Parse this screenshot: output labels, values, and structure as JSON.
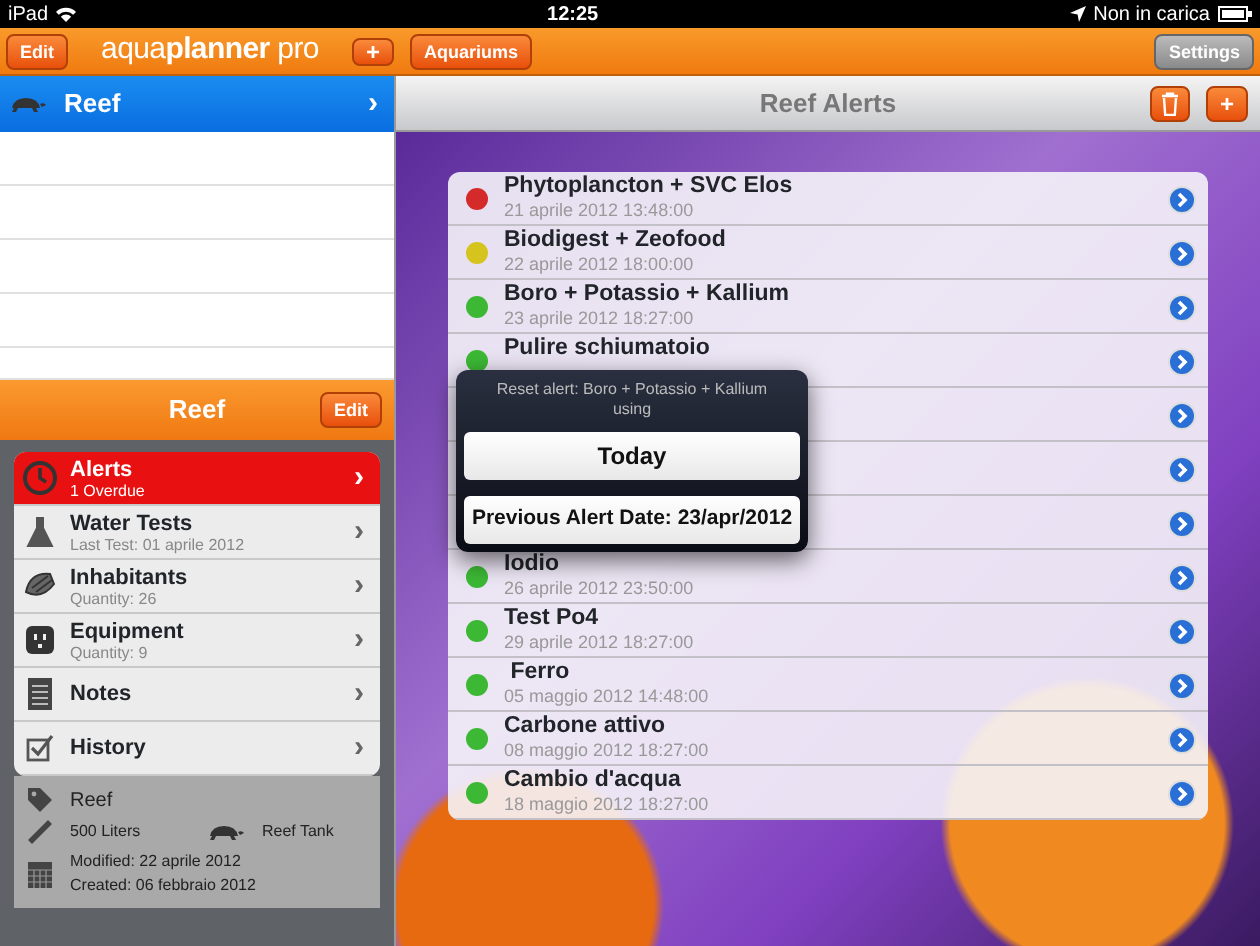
{
  "status_bar": {
    "device": "iPad",
    "time": "12:25",
    "charging": "Non in carica"
  },
  "toolbar": {
    "edit": "Edit",
    "logo_light": "aqua",
    "logo_bold": "planner",
    "logo_suffix": " pro",
    "add": "+",
    "aquariums": "Aquariums",
    "settings": "Settings"
  },
  "aquariums": [
    {
      "name": "Reef",
      "selected": true,
      "chevron": "›"
    }
  ],
  "aquarium_panel": {
    "title": "Reef",
    "edit": "Edit",
    "menu": [
      {
        "kind": "clock",
        "title": "Alerts",
        "subtitle": "1 Overdue",
        "selected": true,
        "chevron": "›"
      },
      {
        "kind": "flask",
        "title": "Water Tests",
        "subtitle": "Last Test: 01 aprile 2012",
        "selected": false,
        "chevron": "›"
      },
      {
        "kind": "shell",
        "title": "Inhabitants",
        "subtitle": "Quantity: 26",
        "selected": false,
        "chevron": "›"
      },
      {
        "kind": "outlet",
        "title": "Equipment",
        "subtitle": "Quantity: 9",
        "selected": false,
        "chevron": "›"
      },
      {
        "kind": "notepad",
        "title": "Notes",
        "selected": false,
        "chevron": "›"
      },
      {
        "kind": "checkbox",
        "title": "History",
        "selected": false,
        "chevron": "›"
      }
    ],
    "info": {
      "name": "Reef",
      "volume": "500 Liters",
      "type": "Reef Tank",
      "modified": "Modified: 22 aprile 2012",
      "created": "Created: 06 febbraio 2012"
    }
  },
  "alerts_header": {
    "title": "Reef Alerts",
    "add": "+"
  },
  "alerts": [
    {
      "kind": "alert",
      "title": "Phytoplancton + SVC Elos",
      "date": "21 aprile 2012 13:48:00",
      "color": "#d42a2a"
    },
    {
      "kind": "alert",
      "title": "Biodigest + Zeofood",
      "date": "22 aprile 2012 18:00:00",
      "color": "#d6c41e"
    },
    {
      "kind": "alert",
      "title": "Boro + Potassio + Kallium",
      "date": "23 aprile 2012 18:27:00",
      "color": "#3cb834"
    },
    {
      "kind": "alert",
      "title": "Pulire schiumatoio",
      "color": "#3cb834"
    },
    {
      "kind": "covered"
    },
    {
      "kind": "covered"
    },
    {
      "kind": "covered"
    },
    {
      "kind": "alert",
      "title": "Iodio",
      "date": "26 aprile 2012 23:50:00",
      "color": "#3cb834"
    },
    {
      "kind": "alert",
      "title": "Test Po4",
      "date": "29 aprile 2012 18:27:00",
      "color": "#3cb834"
    },
    {
      "kind": "alert",
      "title": " Ferro",
      "date": "05 maggio 2012 14:48:00",
      "color": "#3cb834"
    },
    {
      "kind": "alert",
      "title": "Carbone attivo",
      "date": "08 maggio 2012 18:27:00",
      "color": "#3cb834"
    },
    {
      "kind": "alert",
      "title": "Cambio d'acqua",
      "date": "18 maggio 2012 18:27:00",
      "color": "#3cb834"
    }
  ],
  "popover": {
    "message": "Reset alert: Boro + Potassio + Kallium using",
    "buttons": [
      "Today",
      "Previous Alert Date: 23/apr/2012"
    ]
  }
}
